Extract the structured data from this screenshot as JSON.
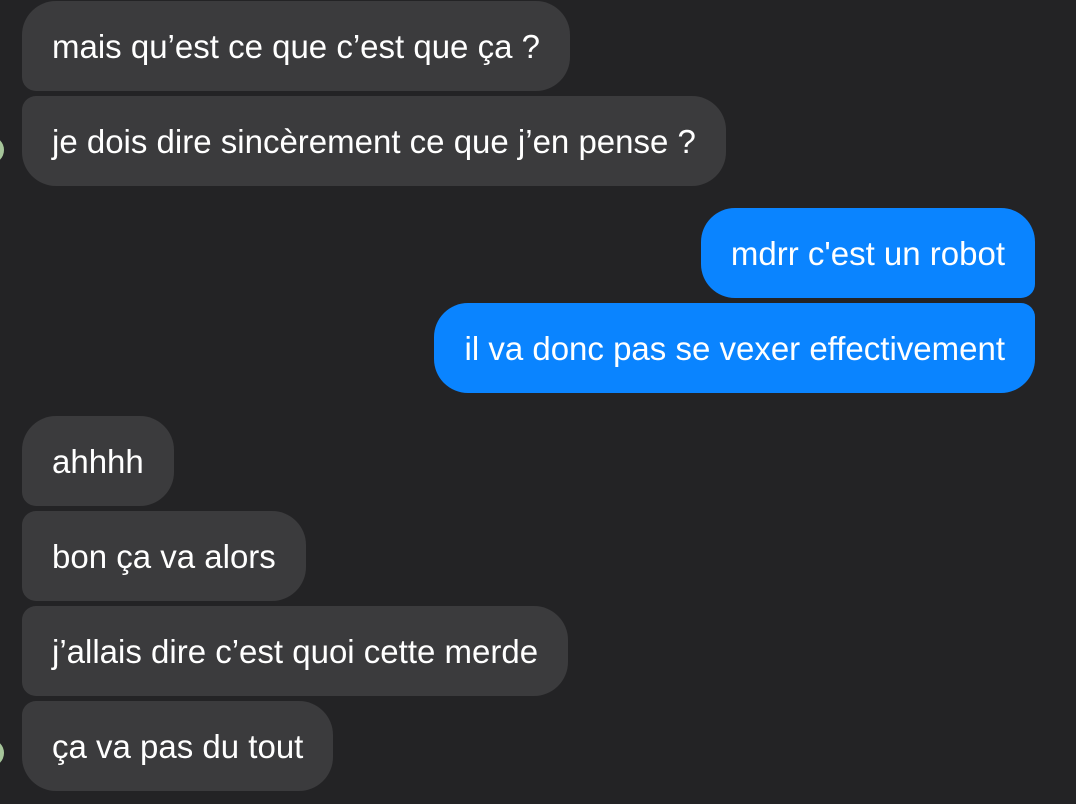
{
  "conversation": {
    "messages": [
      {
        "sender": "them",
        "text": "mais qu’est ce que c’est que ça ?"
      },
      {
        "sender": "them",
        "text": "je dois dire sincèrement ce que j’en pense ?"
      },
      {
        "sender": "me",
        "text": "mdrr c'est un robot"
      },
      {
        "sender": "me",
        "text": "il va donc pas se vexer effectivement"
      },
      {
        "sender": "them",
        "text": "ahhhh"
      },
      {
        "sender": "them",
        "text": "bon ça va alors"
      },
      {
        "sender": "them",
        "text": "j’allais dire c’est quoi cette merde"
      },
      {
        "sender": "them",
        "text": "ça va pas du tout"
      }
    ]
  },
  "colors": {
    "background": "#232325",
    "incoming_bubble": "#3b3b3d",
    "outgoing_bubble": "#0a84ff",
    "text": "#ffffff",
    "avatar": "#a6c59a"
  }
}
